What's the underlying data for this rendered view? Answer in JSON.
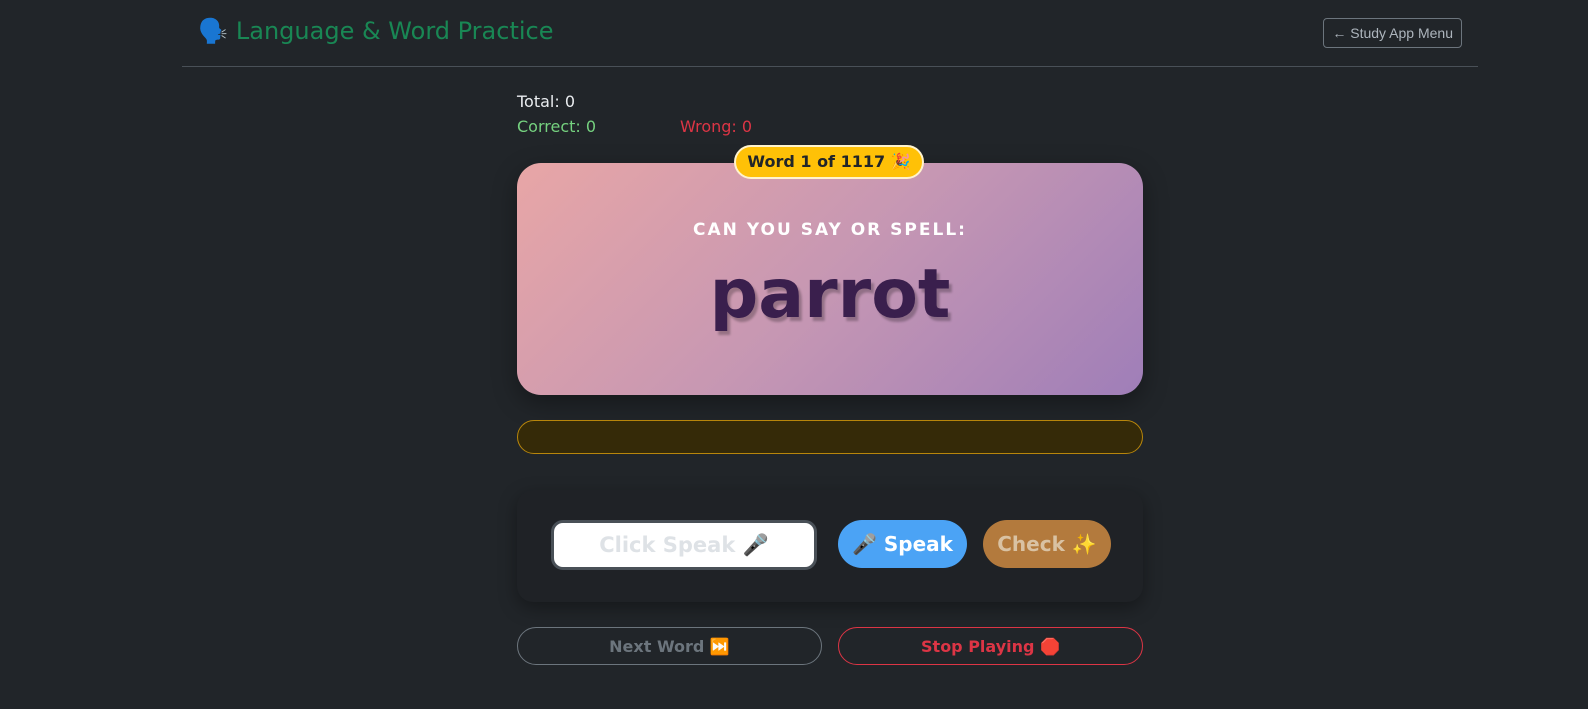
{
  "header": {
    "icon": "🗣️",
    "title": "Language & Word Practice",
    "menu_button": "← Study App Menu"
  },
  "stats": {
    "total": "Total: 0",
    "correct": "Correct: 0",
    "wrong": "Wrong: 0"
  },
  "card": {
    "badge": "Word 1 of 1117 🎉",
    "prompt": "CAN YOU SAY OR SPELL:",
    "word": "parrot"
  },
  "feedback": {
    "text": ""
  },
  "answer": {
    "value": "",
    "placeholder": "Click Speak 🎤",
    "speak_label": "🎤 Speak",
    "check_label": "Check ✨"
  },
  "controls": {
    "next_label": "Next Word ⏭️",
    "stop_label": "Stop Playing 🛑"
  },
  "colors": {
    "background": "#212529",
    "title_green": "#198754",
    "correct_green": "#75d17f",
    "wrong_red": "#dc3545",
    "badge_yellow": "#ffc107",
    "speak_blue": "#4ba3f5",
    "check_brown": "#b37a3d",
    "word_purple": "#3a1f4d"
  }
}
